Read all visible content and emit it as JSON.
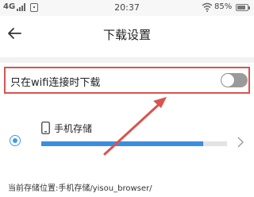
{
  "status_bar": {
    "signal_text": "4G",
    "time": "20:37",
    "battery_text": "85%",
    "battery_level": 0.85
  },
  "header": {
    "back_icon": "arrow-left-icon",
    "title": "下载设置"
  },
  "wifi_only": {
    "label": "只在wifi连接时下载",
    "enabled": false
  },
  "storage": {
    "selected": true,
    "icon": "phone-icon",
    "label": "手机存储",
    "usage_fraction": 0.87
  },
  "current_path": "当前存储位置:手机存储/yisou_browser/",
  "colors": {
    "accent": "#3c8de0",
    "annotation_red": "#d9544f",
    "toggle_off": "#9a9a9a"
  }
}
